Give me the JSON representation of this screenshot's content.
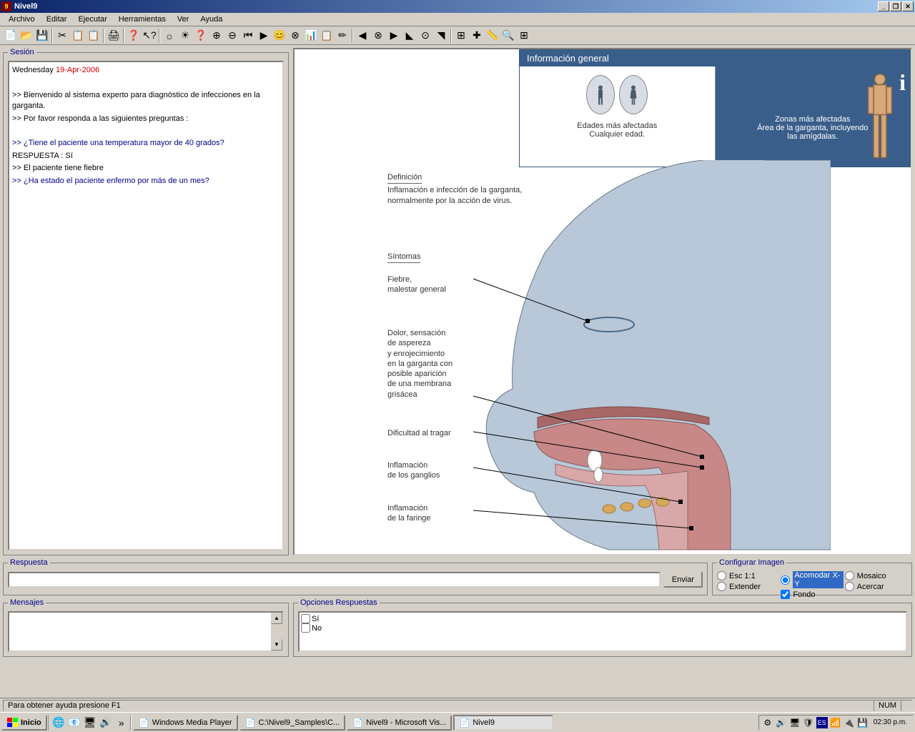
{
  "app": {
    "title": "Nivel9"
  },
  "window_buttons": {
    "min": "_",
    "max": "❐",
    "close": "✕"
  },
  "menu": [
    "Archivo",
    "Editar",
    "Ejecutar",
    "Herramientas",
    "Ver",
    "Ayuda"
  ],
  "toolbar_icons": [
    "📄",
    "📂",
    "💾",
    "|",
    "✂",
    "📋",
    "📋",
    "|",
    "🖨",
    "|",
    "❓",
    "↖?",
    "|",
    "☼",
    "☀",
    "❓",
    "⊕",
    "⊖",
    "⏮",
    "▶",
    "😊",
    "⊗",
    "📊",
    "📋",
    "✏",
    "|",
    "◀",
    "⊗",
    "▶",
    "◣",
    "⊙",
    "◥",
    "|",
    "⊞",
    "✚",
    "📏",
    "🔍",
    "⊞"
  ],
  "session": {
    "legend": "Sesión",
    "day": "Wednesday",
    "date": "19-Apr-2006",
    "lines": [
      {
        "prefix": ">>",
        "text": "Bienvenido al sistema experto para diagnóstico de infecciones en la garganta.",
        "color": "#000"
      },
      {
        "prefix": ">>",
        "text": "Por favor responda a las siguientes preguntas :",
        "color": "#000"
      },
      {
        "prefix": "",
        "text": "",
        "color": "#000"
      },
      {
        "prefix": ">>",
        "text": "¿Tiene el paciente una temperatura mayor de 40 grados?",
        "color": "#00008b"
      },
      {
        "prefix": "",
        "text": "RESPUESTA : Sí",
        "color": "#000"
      },
      {
        "prefix": ">>",
        "text": "El paciente tiene fiebre",
        "color": "#000"
      },
      {
        "prefix": ">>",
        "text": "¿Ha estado el paciente enfermo por más de un mes?",
        "color": "#00008b"
      }
    ]
  },
  "med": {
    "title": "Información general",
    "ages_label": "Edades más afectadas",
    "ages_value": "Cualquier edad.",
    "zones_label": "Zonas más afectadas",
    "zones_value": "Área de la garganta, incluyendo las amígdalas.",
    "def_title": "Definición",
    "def_text": "Inflamación e infección de la garganta, normalmente por la acción de virus.",
    "sym_title": "Síntomas",
    "sym1": "Fiebre,\nmalestar general",
    "sym2": "Dolor, sensación\nde aspereza\ny enrojecimiento\nen la garganta con\nposible aparición\nde una membrana\ngrisácea",
    "sym3": "Dificultad al tragar",
    "sym4": "Inflamación\nde los ganglios",
    "sym5": "Inflamación\nde la faringe"
  },
  "respuesta": {
    "legend": "Respuesta",
    "button": "Enviar"
  },
  "config": {
    "legend": "Configurar Imagen",
    "opts": {
      "esc": "Esc 1:1",
      "extender": "Extender",
      "acomodar": "Acomodar X-Y",
      "fondo": "Fondo",
      "mosaico": "Mosaico",
      "acercar": "Acercar"
    }
  },
  "mensajes": {
    "legend": "Mensajes"
  },
  "opciones": {
    "legend": "Opciones Respuestas",
    "items": [
      "Sí",
      "No"
    ]
  },
  "status": {
    "help": "Para obtener ayuda presione F1",
    "num": "NUM"
  },
  "taskbar": {
    "start": "Inicio",
    "tasks": [
      {
        "label": "Windows Media Player",
        "active": false
      },
      {
        "label": "C:\\Nivel9_Samples\\C...",
        "active": false
      },
      {
        "label": "Nivel9 - Microsoft Vis...",
        "active": false
      },
      {
        "label": "Nivel9",
        "active": true
      }
    ],
    "time": "02:30 p.m."
  }
}
